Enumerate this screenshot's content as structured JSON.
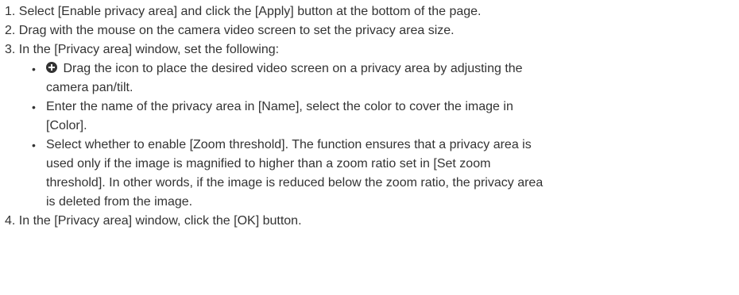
{
  "steps": {
    "s1": "1. Select [Enable privacy area] and click the [Apply] button at the bottom of the page.",
    "s2": "2. Drag with the mouse on the camera video screen to set the privacy area size.",
    "s3": "3. In the [Privacy area] window, set the following:",
    "s4": "4. In the [Privacy area] window, click the [OK] button."
  },
  "bullets": [
    {
      "icon": "move-icon",
      "lines": [
        "Drag the icon to place the desired video screen on a privacy area by adjusting the",
        "camera pan/tilt."
      ]
    },
    {
      "lines": [
        "Enter the name of the privacy area in [Name], select the color to cover the image in",
        "[Color]."
      ]
    },
    {
      "lines": [
        "Select whether to enable [Zoom threshold]. The function ensures that a privacy area is",
        "used only if the image is magnified to higher than a zoom ratio set in [Set zoom",
        "threshold]. In other words, if the image is reduced below the zoom ratio, the privacy area",
        "is deleted from the image."
      ]
    }
  ]
}
